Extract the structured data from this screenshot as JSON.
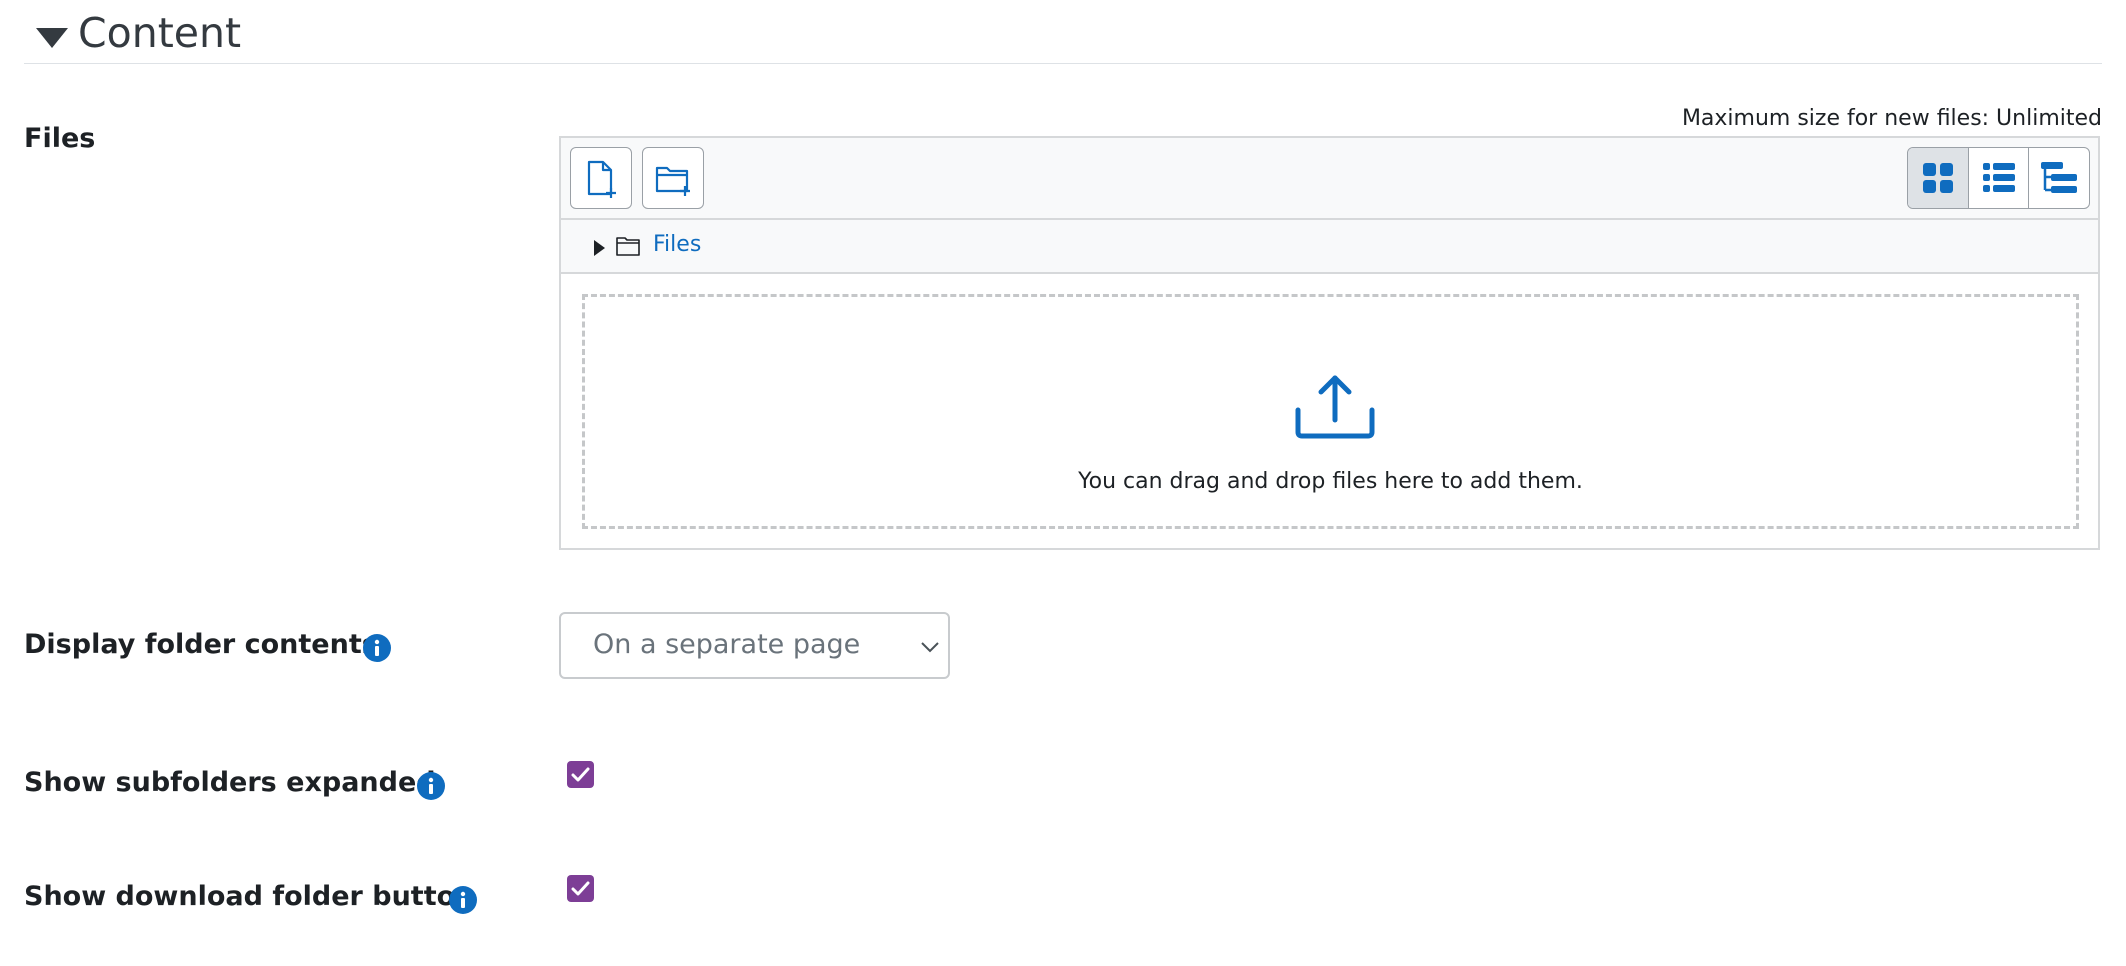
{
  "section": {
    "title": "Content"
  },
  "files": {
    "label": "Files",
    "max_size_text": "Maximum size for new files: Unlimited",
    "path_link": "Files",
    "drop_message": "You can drag and drop files here to add them."
  },
  "display": {
    "label": "Display folder contents",
    "selected": "On a separate page"
  },
  "subfolders": {
    "label": "Show subfolders expanded",
    "checked": true
  },
  "download": {
    "label": "Show download folder button",
    "checked": true
  },
  "colors": {
    "accent": "#0f6cbf",
    "checkbox": "#7d3e96"
  },
  "icons": [
    "caret-down-icon",
    "add-file-icon",
    "add-folder-icon",
    "grid-view-icon",
    "list-view-icon",
    "tree-view-icon",
    "folder-icon",
    "upload-icon",
    "info-icon",
    "chevron-down-icon",
    "check-icon"
  ]
}
